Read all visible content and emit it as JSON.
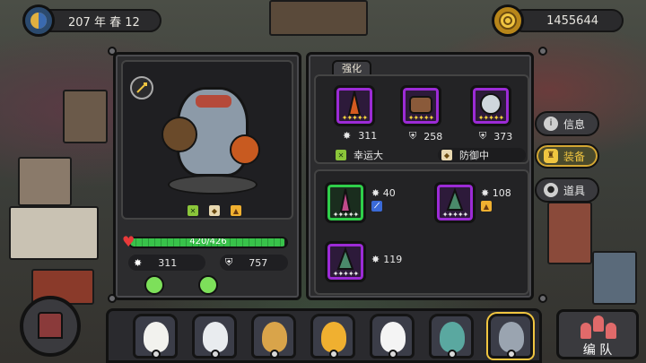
{
  "top": {
    "date_text": "207 年 春 12",
    "gold": "1455644"
  },
  "hero_panel": {
    "hp_text": "420/426",
    "hp_fraction": 0.986,
    "attack": "311",
    "defense": "757",
    "potions": [
      "potion-green-icon",
      "potion-green-icon"
    ]
  },
  "equip_panel": {
    "enhance_label": "强化",
    "equipped": [
      {
        "name": "weapon",
        "value": "311",
        "icon": "attack-icon"
      },
      {
        "name": "armor",
        "value": "258",
        "icon": "shield-icon"
      },
      {
        "name": "shield",
        "value": "373",
        "icon": "shield-icon"
      }
    ],
    "traits": [
      {
        "label": "幸运大",
        "icon": "luck-icon"
      },
      {
        "label": "防御中",
        "icon": "defense-icon"
      }
    ],
    "inventory": [
      {
        "value": "40",
        "icon": "attack-icon",
        "rarity": "green"
      },
      {
        "value": "108",
        "icon": "attack-icon",
        "rarity": "purple"
      },
      {
        "value": "119",
        "icon": "attack-icon",
        "rarity": "purple"
      }
    ]
  },
  "side_tabs": [
    {
      "label": "信息",
      "icon": "info-icon",
      "active": false
    },
    {
      "label": "装备",
      "icon": "equipment-icon",
      "active": true
    },
    {
      "label": "道具",
      "icon": "item-bag-icon",
      "active": false
    }
  ],
  "team_button": {
    "label": "编 队"
  },
  "heroes": [
    "duck-hero",
    "polar-bear-hero",
    "giraffe-hero",
    "tiger-hero",
    "goose-hero",
    "crocodile-hero",
    "rhino-hero"
  ],
  "colors": {
    "rarity_purple": "#9c2bd6",
    "rarity_green": "#2fcf4a",
    "hp_green": "#38c24a",
    "tab_active": "#f0c540"
  }
}
